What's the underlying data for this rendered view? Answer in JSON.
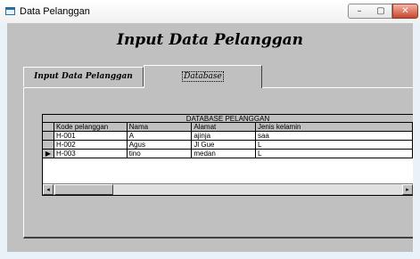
{
  "window": {
    "title": "Data Pelanggan",
    "minimize": "–",
    "maximize": "▢",
    "close": "✕"
  },
  "form": {
    "heading": "Input Data Pelanggan"
  },
  "tabs": [
    {
      "label": "Input Data Pelanggan",
      "selected": false
    },
    {
      "label": "Database",
      "selected": true
    }
  ],
  "grid": {
    "caption": "DATABASE PELANGGAN",
    "columns": [
      "Kode pelanggan",
      "Nama",
      "Alamat",
      "Jenis kelamin"
    ],
    "rows": [
      [
        "H-001",
        "A",
        "ajinja",
        "saa"
      ],
      [
        "H-002",
        "Agus",
        "Jl Gue",
        "L"
      ],
      [
        "H-003",
        "tino",
        "medan",
        "L"
      ]
    ],
    "current_row_marker": "▶",
    "scroll_left": "◂",
    "scroll_right": "▸"
  }
}
